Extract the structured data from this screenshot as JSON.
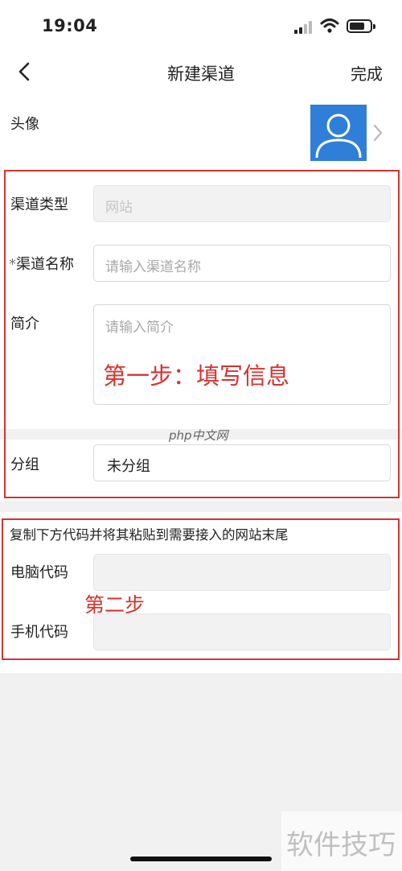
{
  "status": {
    "time": "19:04"
  },
  "nav": {
    "title": "新建渠道",
    "done_label": "完成"
  },
  "avatar": {
    "label": "头像"
  },
  "form": {
    "channel_type_label": "渠道类型",
    "channel_type_value": "网站",
    "channel_name_required": "*",
    "channel_name_label": "渠道名称",
    "channel_name_placeholder": "请输入渠道名称",
    "intro_label": "简介",
    "intro_placeholder": "请输入简介",
    "group_label": "分组",
    "group_value": "未分组"
  },
  "code": {
    "instruction": "复制下方代码并将其粘贴到需要接入的网站末尾",
    "pc_label": "电脑代码",
    "mobile_label": "手机代码"
  },
  "annotations": {
    "step1": "第一步：填写信息",
    "step2": "第二步"
  },
  "watermarks": {
    "center": "php中文网",
    "corner": "软件技巧"
  },
  "colors": {
    "accent_red": "#d8322f",
    "avatar_blue": "#2f7fd8"
  }
}
